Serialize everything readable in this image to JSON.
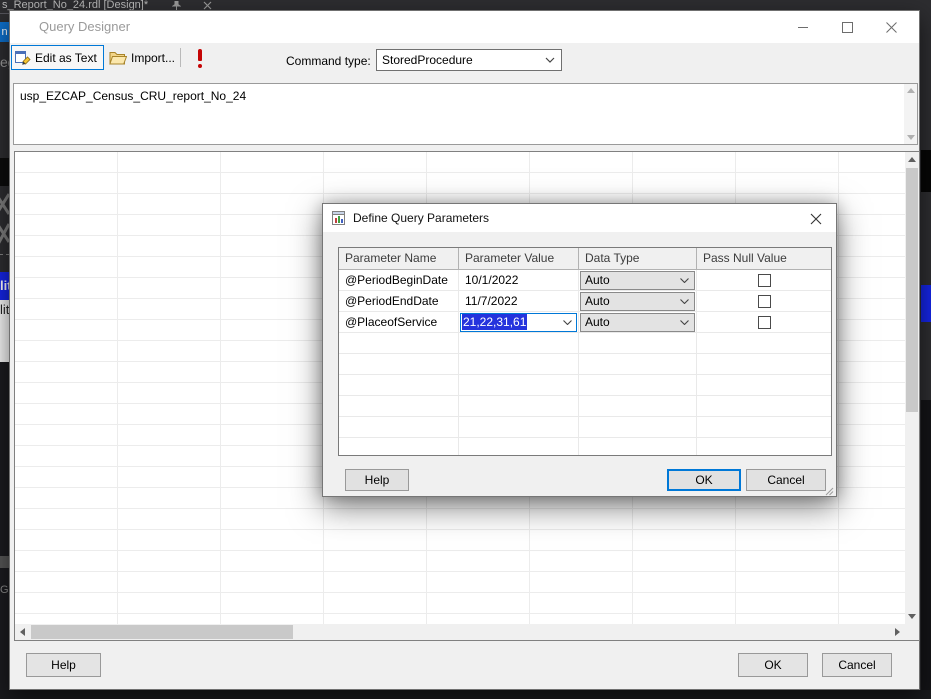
{
  "backdrop": {
    "tab_title": "s_Report_No_24.rdl [Design]*",
    "left_fragments": {
      "toolbox_letter": "n",
      "partial_text_top": "egi",
      "selected_item": "lit",
      "list_item": "lit",
      "partial_text_bottom": "Gro"
    }
  },
  "query_designer": {
    "title": "Query Designer",
    "toolbar": {
      "edit_as_text_label": "Edit as Text",
      "import_label": "Import...",
      "command_type_label": "Command type:",
      "command_type_value": "StoredProcedure"
    },
    "query_text": "usp_EZCAP_Census_CRU_report_No_24",
    "footer": {
      "help_label": "Help",
      "ok_label": "OK",
      "cancel_label": "Cancel"
    }
  },
  "dialog": {
    "title": "Define Query Parameters",
    "table": {
      "headers": [
        "Parameter Name",
        "Parameter Value",
        "Data Type",
        "Pass Null Value"
      ],
      "rows": [
        {
          "name": "@PeriodBeginDate",
          "value": "10/1/2022",
          "data_type": "Auto",
          "pass_null_checked": false,
          "value_editing": false
        },
        {
          "name": "@PeriodEndDate",
          "value": "11/7/2022",
          "data_type": "Auto",
          "pass_null_checked": false,
          "value_editing": false
        },
        {
          "name": "@PlaceofService",
          "value": "21,22,31,61",
          "data_type": "Auto",
          "pass_null_checked": false,
          "value_editing": true
        }
      ],
      "empty_row_count": 7
    },
    "buttons": {
      "help_label": "Help",
      "ok_label": "OK",
      "cancel_label": "Cancel"
    }
  },
  "colors": {
    "accent": "#0078d7",
    "value_selection_blue": "#2533dd",
    "backdrop_selection_blue": "#1525e5",
    "error_red": "#c50505"
  }
}
